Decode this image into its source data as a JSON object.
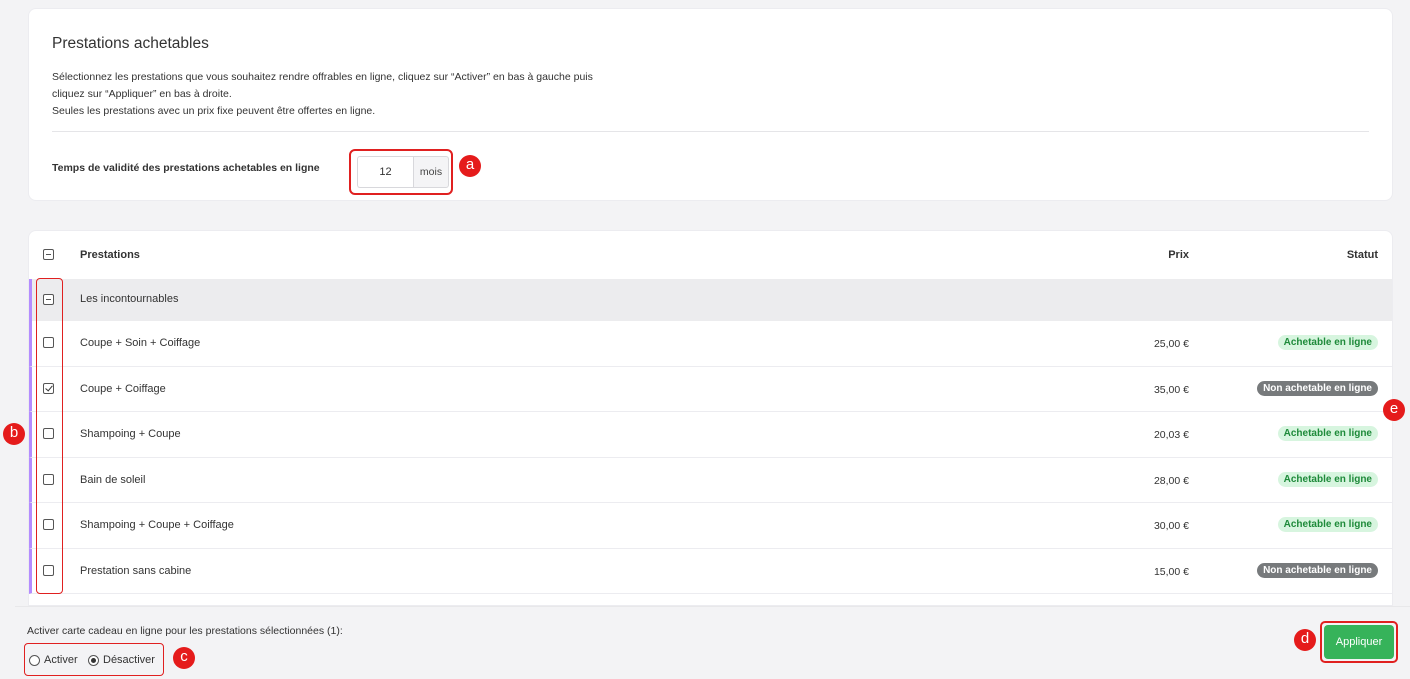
{
  "settings": {
    "title": "Prestations achetables",
    "description_line1": "Sélectionnez les prestations que vous souhaitez rendre offrables en ligne, cliquez sur “Activer” en bas à gauche puis",
    "description_line2": "cliquez sur “Appliquer” en bas à droite.",
    "description_line3": "Seules les prestations avec un prix fixe peuvent être offertes en ligne.",
    "validity_label": "Temps de validité des prestations achetables en ligne",
    "validity_value": "12",
    "validity_unit": "mois"
  },
  "markers": {
    "a": "a",
    "b": "b",
    "c": "c",
    "d": "d",
    "e": "e"
  },
  "table": {
    "col_prestations": "Prestations",
    "col_prix": "Prix",
    "col_statut": "Statut",
    "group_name": "Les incontournables",
    "rows": [
      {
        "name": "Coupe + Soin + Coiffage",
        "price": "25,00 €",
        "status": "Achetable en ligne",
        "checked": false
      },
      {
        "name": "Coupe + Coiffage",
        "price": "35,00 €",
        "status": "Non achetable en ligne",
        "checked": true
      },
      {
        "name": "Shampoing + Coupe",
        "price": "20,03 €",
        "status": "Achetable en ligne",
        "checked": false
      },
      {
        "name": "Bain de soleil",
        "price": "28,00 €",
        "status": "Achetable en ligne",
        "checked": false
      },
      {
        "name": "Shampoing + Coupe + Coiffage",
        "price": "30,00 €",
        "status": "Achetable en ligne",
        "checked": false
      },
      {
        "name": "Prestation sans cabine",
        "price": "15,00 €",
        "status": "Non achetable en ligne",
        "checked": false
      }
    ]
  },
  "footer": {
    "label": "Activer carte cadeau en ligne pour les prestations sélectionnées (1):",
    "radio_activer": "Activer",
    "radio_desactiver": "Désactiver",
    "selected": "Désactiver",
    "apply_label": "Appliquer"
  },
  "colors": {
    "accent_green": "#36b35a",
    "callout_red": "#e51b1b",
    "group_stripe": "#b48cff",
    "badge_ok_bg": "#d7f5df",
    "badge_no_bg": "#777a7c"
  }
}
